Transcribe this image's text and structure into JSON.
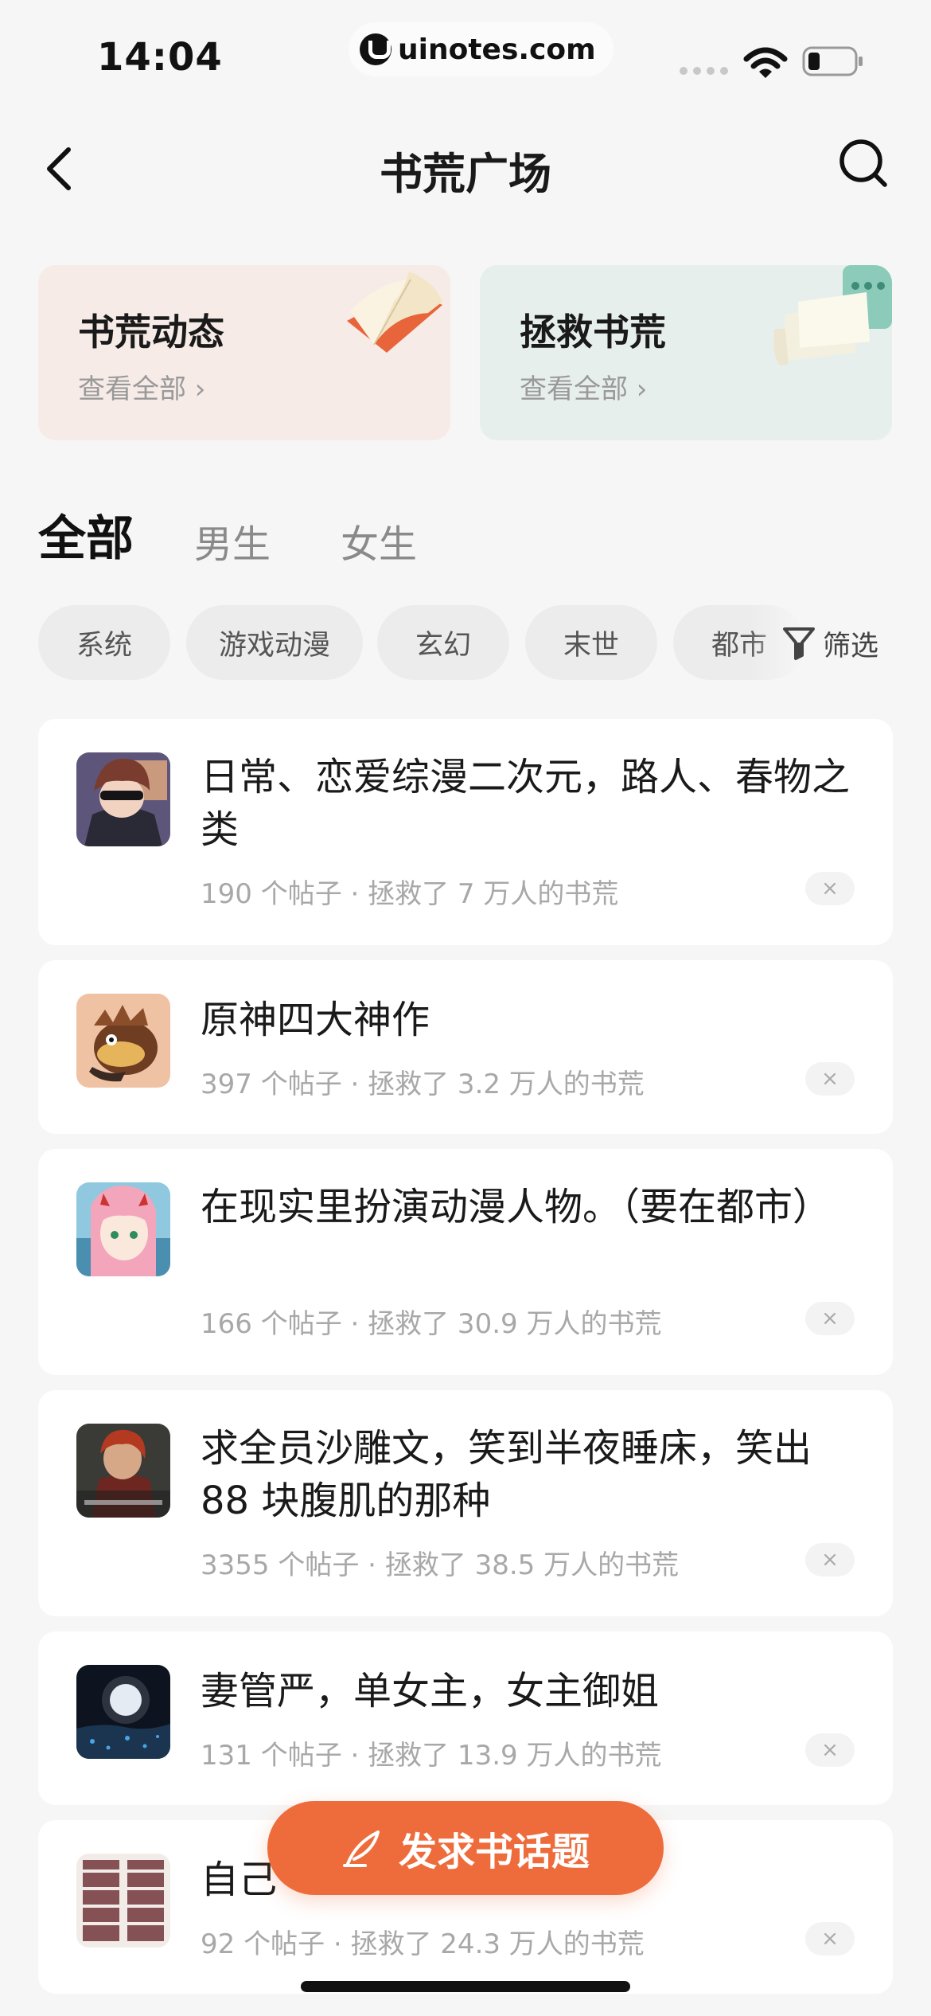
{
  "status_bar": {
    "time": "14:04",
    "watermark": "uinotes.com",
    "icons": [
      "signal-icon",
      "wifi-icon",
      "battery-icon"
    ]
  },
  "nav": {
    "back_icon": "chevron-left-icon",
    "title": "书荒广场",
    "search_icon": "search-icon"
  },
  "cards": [
    {
      "title": "书荒动态",
      "subtitle": "查看全部 ›",
      "icon": "open-book-icon"
    },
    {
      "title": "拯救书荒",
      "subtitle": "查看全部 ›",
      "icon": "paper-scroll-icon"
    }
  ],
  "tabs": [
    {
      "label": "全部",
      "active": true
    },
    {
      "label": "男生",
      "active": false
    },
    {
      "label": "女生",
      "active": false
    }
  ],
  "chips": [
    "系统",
    "游戏动漫",
    "玄幻",
    "末世",
    "都市"
  ],
  "filter": {
    "label": "筛选",
    "icon": "filter-icon"
  },
  "topics": [
    {
      "title": "日常、恋爱综漫二次元，路人、春物之类",
      "meta": "190 个帖子 · 拯救了 7 万人的书荒",
      "close": "×"
    },
    {
      "title": "原神四大神作",
      "meta": "397 个帖子 · 拯救了 3.2 万人的书荒",
      "close": "×"
    },
    {
      "title": "在现实里扮演动漫人物。（要在都市）",
      "meta": "166 个帖子 · 拯救了 30.9 万人的书荒",
      "close": "×"
    },
    {
      "title": "求全员沙雕文，笑到半夜睡床，笑出88 块腹肌的那种",
      "meta": "3355 个帖子 · 拯救了 38.5 万人的书荒",
      "close": "×"
    },
    {
      "title": "妻管严，单女主，女主御姐",
      "meta": "131 个帖子 · 拯救了 13.9 万人的书荒",
      "close": "×"
    },
    {
      "title": "自己",
      "meta": "92 个帖子 · 拯救了 24.3 万人的书荒",
      "close": "×"
    }
  ],
  "fab": {
    "label": "发求书话题",
    "icon": "quill-icon"
  },
  "colors": {
    "accent": "#ee6c3b",
    "background": "#f6f6f6",
    "card_warm": "#f6ebe7",
    "card_cool": "#e7efed"
  }
}
